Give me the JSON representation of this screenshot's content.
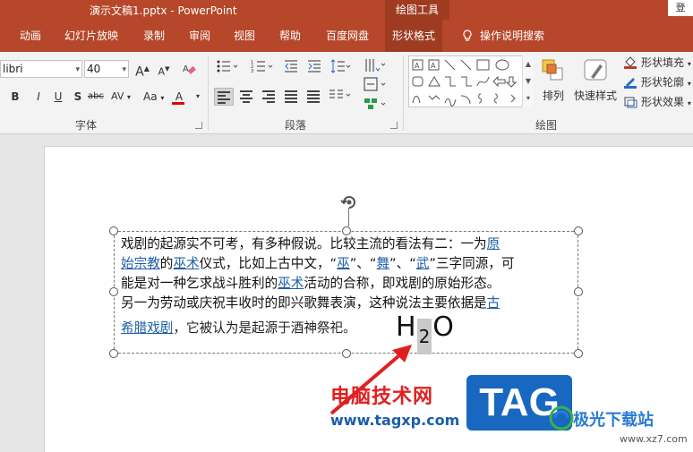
{
  "titlebar": {
    "doc_title": "演示文稿1.pptx  -  PowerPoint",
    "context_tool": "绘图工具",
    "login": "登"
  },
  "tabs": [
    {
      "label": "动画"
    },
    {
      "label": "幻灯片放映"
    },
    {
      "label": "录制"
    },
    {
      "label": "审阅"
    },
    {
      "label": "视图"
    },
    {
      "label": "帮助"
    },
    {
      "label": "百度网盘"
    },
    {
      "label": "形状格式",
      "active": true
    },
    {
      "label": "操作说明搜索"
    }
  ],
  "ribbon": {
    "font": {
      "name": "libri",
      "size": "40",
      "grow": "A",
      "shrink": "A",
      "bold": "B",
      "italic": "I",
      "underline": "U",
      "shadow": "S",
      "strike": "abc",
      "spacing": "AV",
      "case": "Aa",
      "color": "A",
      "group_label": "字体"
    },
    "paragraph": {
      "group_label": "段落"
    },
    "drawing": {
      "arrange": "排列",
      "quick_styles": "快速样式",
      "fill": "形状填充",
      "outline": "形状轮廓",
      "effects": "形状效果",
      "group_label": "绘图"
    },
    "accent": "#b7472a"
  },
  "slide": {
    "lines": [
      "戏剧的起源实不可考，有多种假说。比较主流的看法有二：一为",
      "原",
      "始宗教",
      "的",
      "巫术",
      "仪式，比如上古中文，“",
      "巫",
      "”、“",
      "舞",
      "”、“",
      "武",
      "”三字同源，可",
      "能是对一种乞求战斗胜利的",
      "巫术",
      "活动的合称，即戏剧的原始形态。",
      "另一为劳动或庆祝丰收时的即兴歌舞表演，这种说法主要依据是",
      "古",
      "希腊戏剧",
      "，它被认为是起源于酒神祭祀。"
    ],
    "formula": {
      "base": "H",
      "subscript": "2",
      "tail": "O"
    }
  },
  "watermarks": {
    "cn": "电脑技术网",
    "url": "www.tagxp.com",
    "tag": "TAG",
    "xz_brand": "极光下载站",
    "xz_url": "www.xz7.com"
  }
}
